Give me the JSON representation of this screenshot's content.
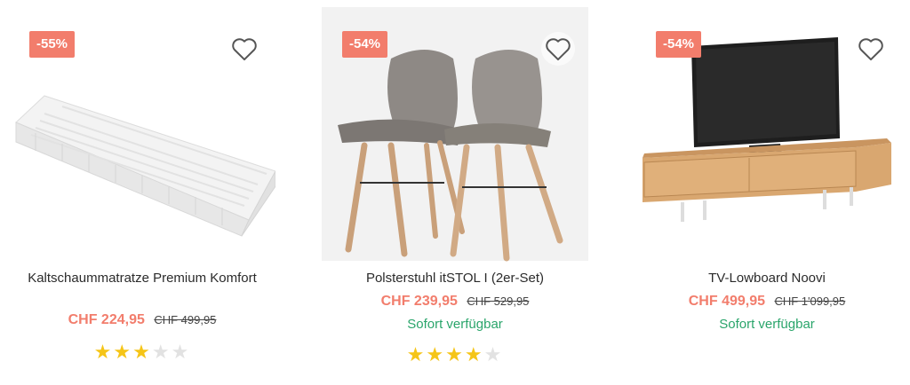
{
  "colors": {
    "accent": "#f27d6c",
    "available": "#2aa56b",
    "star_on": "#f5c518",
    "star_off": "#e2e2e2"
  },
  "products": [
    {
      "badge": "-55%",
      "name": "Kaltschaummatratze Premium Komfort",
      "price": "CHF 224,95",
      "old_price": "CHF 499,95",
      "availability": "",
      "rating": 3,
      "rating_max": 5,
      "favorite_icon": "heart-outline-icon"
    },
    {
      "badge": "-54%",
      "name": "Polsterstuhl itSTOL I (2er-Set)",
      "price": "CHF 239,95",
      "old_price": "CHF 529,95",
      "availability": "Sofort verfügbar",
      "rating": 4,
      "rating_max": 5,
      "favorite_icon": "heart-outline-icon"
    },
    {
      "badge": "-54%",
      "name": "TV-Lowboard Noovi",
      "price": "CHF 499,95",
      "old_price": "CHF 1'099,95",
      "availability": "Sofort verfügbar",
      "favorite_icon": "heart-outline-icon"
    }
  ]
}
